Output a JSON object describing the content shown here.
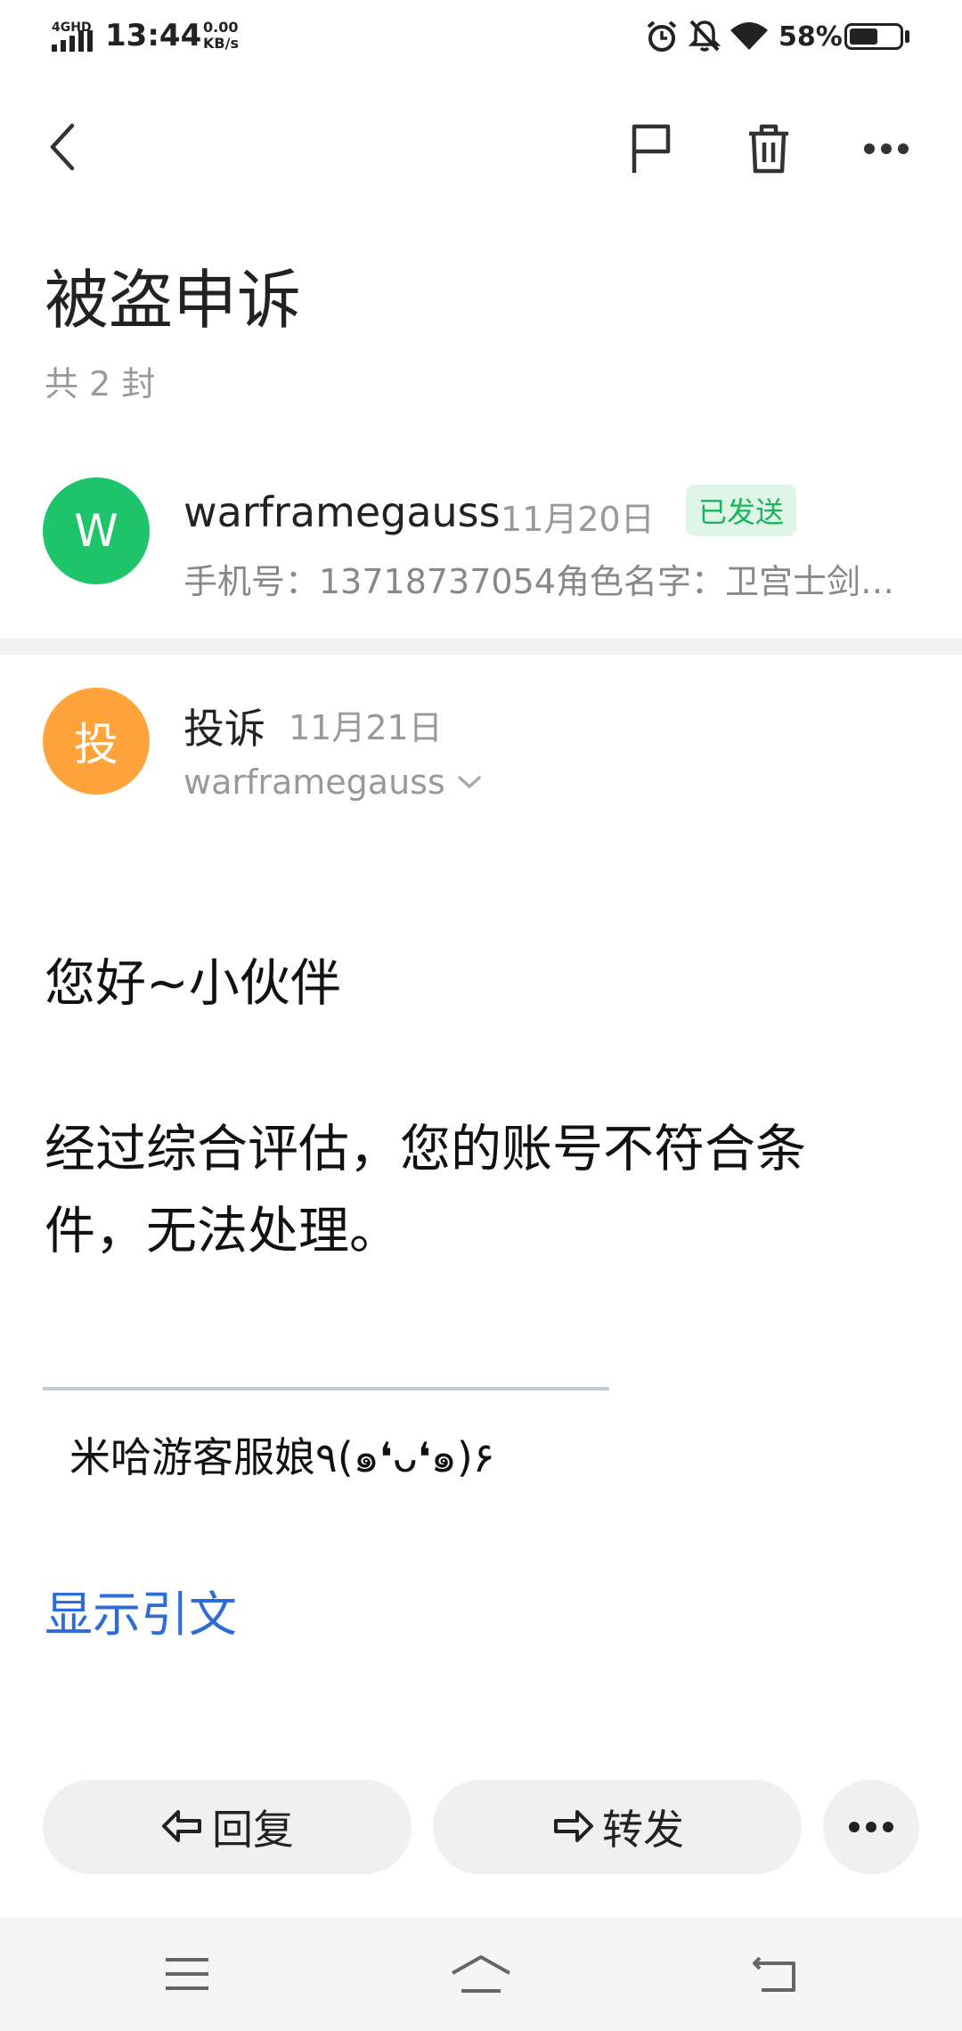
{
  "status_bar": {
    "network": "4GHD",
    "time": "13:44",
    "speed_value": "0.00",
    "speed_unit": "KB/s",
    "battery_percent": "58%",
    "battery_level": 0.58
  },
  "header": {
    "back_icon": "back-arrow-icon",
    "flag_icon": "flag-icon",
    "delete_icon": "trash-icon",
    "more_icon": "more-dots-icon"
  },
  "thread": {
    "title": "被盗申诉",
    "count": "共 2 封"
  },
  "messages": [
    {
      "avatar_letter": "W",
      "avatar_color": "#1dc46a",
      "sender": "warframegauss",
      "date": "11月20日",
      "badge": "已发送",
      "preview": "手机号：13718737054角色名字：卫宫士剑…"
    },
    {
      "avatar_letter": "投",
      "avatar_color": "#ffa33a",
      "sender": "投诉",
      "date": "11月21日",
      "recipient": "warframegauss"
    }
  ],
  "email_body": {
    "greeting": "您好~小伙伴",
    "line1": "经过综合评估，您的账号不符合条",
    "line2": "件，无法处理。",
    "signature": "米哈游客服娘٩(๑❛ᴗ❛๑)۶",
    "show_quote": "显示引文"
  },
  "actions": {
    "reply": "回复",
    "forward": "转发"
  },
  "colors": {
    "link": "#2f6bd6",
    "sent_badge_bg": "#dff5e8",
    "sent_badge_text": "#1bb45c"
  }
}
